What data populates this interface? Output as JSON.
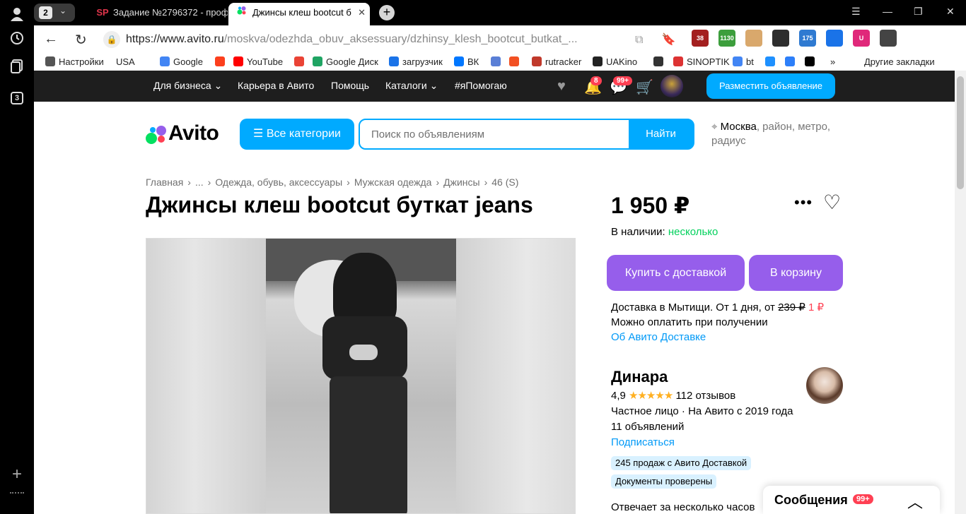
{
  "browser": {
    "tab_count": "2",
    "tabs": [
      {
        "favicon": "SP",
        "label": "Задание №2796372 - проф"
      },
      {
        "favicon": "avito",
        "label": "Джинсы клеш bootcut б",
        "close": "✕"
      }
    ],
    "new_tab": "+",
    "sidebar_counter": "3",
    "url_host": "https://www.avito.ru",
    "url_path": "/moskva/odezhda_obuv_aksessuary/dzhinsy_klesh_bootcut_butkat_...",
    "extensions": [
      {
        "icon": "shield-badge",
        "text": "38",
        "color": "#a31f1f"
      },
      {
        "icon": "speedometer",
        "text": "1130",
        "color": "#3c9e3c"
      },
      {
        "icon": "blocks",
        "text": "",
        "color": "#d9a86c"
      },
      {
        "icon": "pocket",
        "text": "",
        "color": "#2e2e2e"
      },
      {
        "icon": "calendar",
        "text": "175",
        "color": "#2f7ad1"
      },
      {
        "icon": "vpn",
        "text": "",
        "color": "#1a73e8"
      },
      {
        "icon": "ublock",
        "text": "U",
        "color": "#e0287a"
      },
      {
        "icon": "translate",
        "text": "",
        "color": "#444444"
      }
    ]
  },
  "bookmarks": [
    {
      "label": "Настройки",
      "color": "#555555"
    },
    {
      "label": "USA",
      "color": ""
    },
    {
      "label": "Google",
      "color": "#4285f4"
    },
    {
      "label": "",
      "color": "#fc3f1d"
    },
    {
      "label": "YouTube",
      "color": "#ff0000"
    },
    {
      "label": "",
      "color": "#ea4335"
    },
    {
      "label": "Google Диск",
      "color": "#1fa463"
    },
    {
      "label": "загрузчик",
      "color": "#1a73e8"
    },
    {
      "label": "ВК",
      "color": "#0077ff"
    },
    {
      "label": "",
      "color": "#5a7fd6"
    },
    {
      "label": "",
      "color": "#f25022"
    },
    {
      "label": "rutracker",
      "color": "#c0392b"
    },
    {
      "label": "UAKino",
      "color": "#222222"
    },
    {
      "label": "",
      "color": "#333333"
    },
    {
      "label": "SINOPTIK",
      "color": "#d33"
    },
    {
      "label": "bt",
      "color": "#4285f4"
    },
    {
      "label": "",
      "color": "#1e90ff"
    },
    {
      "label": "",
      "color": "#2d7ff9"
    },
    {
      "label": "",
      "color": "#000000"
    },
    {
      "label": "»",
      "color": ""
    },
    {
      "label": "Другие закладки",
      "color": ""
    }
  ],
  "avito_nav": {
    "items": [
      "Для бизнеса",
      "Карьера в Авито",
      "Помощь",
      "Каталоги",
      "#яПомогаю"
    ],
    "notif_badge": "8",
    "messages_badge": "99+",
    "post_button": "Разместить объявление"
  },
  "header": {
    "logo": "Avito",
    "categories_button": "Все категории",
    "search_placeholder": "Поиск по объявлениям",
    "search_button": "Найти",
    "location_city": "Москва",
    "location_rest": ", район, метро, радиус"
  },
  "breadcrumb": [
    "Главная",
    "...",
    "Одежда, обувь, аксессуары",
    "Мужская одежда",
    "Джинсы",
    "46 (S)"
  ],
  "listing": {
    "title": "Джинсы клеш bootcut буткат jeans",
    "price": "1 950 ₽",
    "stock_label": "В наличии:",
    "stock_value": "несколько",
    "buy_button": "Купить с доставкой",
    "cart_button": "В корзину",
    "delivery_line": "Доставка в Мытищи. От 1 дня, от",
    "delivery_old_price": "239 ₽",
    "delivery_new_price": "1 ₽",
    "payment_note": "Можно оплатить при получении",
    "delivery_link": "Об Авито Доставке"
  },
  "seller": {
    "name": "Динара",
    "rating": "4,9",
    "stars": "★★★★★",
    "reviews": "112 отзывов",
    "type": "Частное лицо · На Авито с 2019 года",
    "listings": "11 объявлений",
    "subscribe": "Подписаться",
    "chip_sales": "245 продаж с Авито Доставкой",
    "chip_docs": "Документы проверены",
    "responds": "Отвечает за несколько часов"
  },
  "messages_widget": {
    "label": "Сообщения",
    "badge": "99+"
  }
}
